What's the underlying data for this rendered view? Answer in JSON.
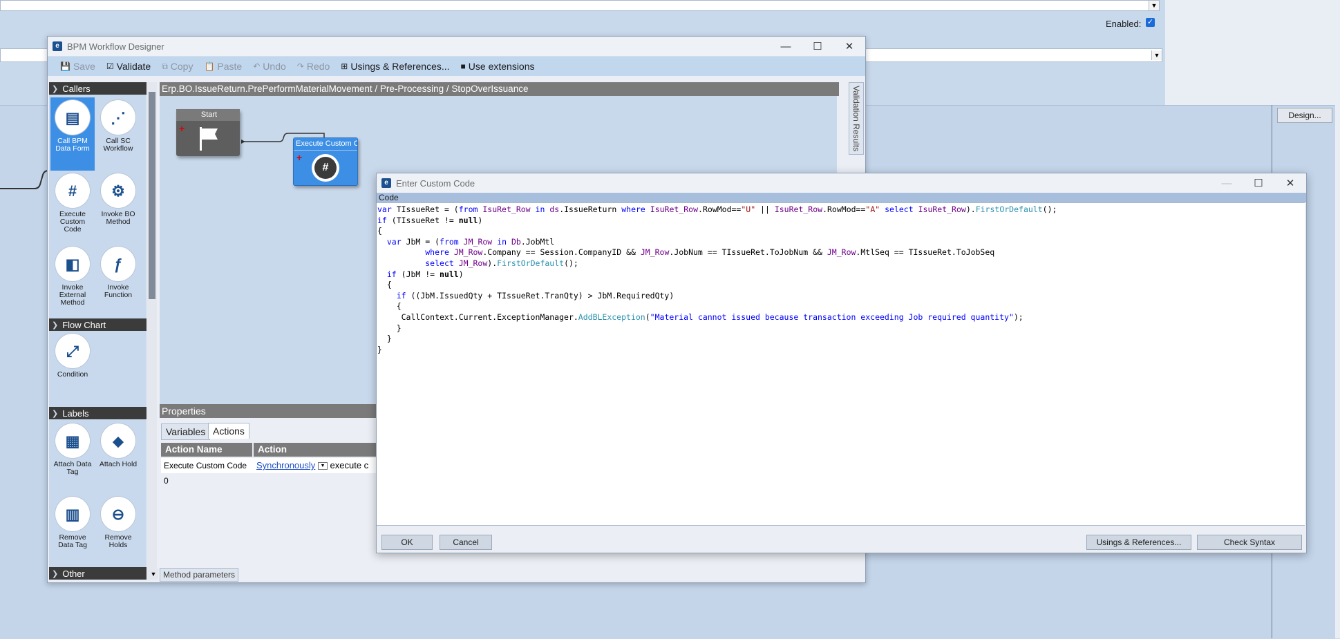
{
  "background": {
    "enabled_label": "Enabled:",
    "enabled_checked": true,
    "design_button": "Design..."
  },
  "bpm_window": {
    "title": "BPM Workflow Designer",
    "toolbar": {
      "save": "Save",
      "validate": "Validate",
      "copy": "Copy",
      "paste": "Paste",
      "undo": "Undo",
      "redo": "Redo",
      "usings": "Usings & References...",
      "extensions": "Use extensions"
    },
    "path": "Erp.BO.IssueReturn.PrePerformMaterialMovement / Pre-Processing / StopOverIssuance",
    "validation_tab": "Validation Results",
    "toolbox": {
      "callers_header": "Callers",
      "callers": [
        {
          "label": "Call BPM Data Form",
          "icon": "form-icon"
        },
        {
          "label": "Call SC Workflow",
          "icon": "workflow-icon"
        },
        {
          "label": "Execute Custom Code",
          "icon": "hash-document-icon"
        },
        {
          "label": "Invoke BO Method",
          "icon": "bo-method-icon"
        },
        {
          "label": "Invoke External Method",
          "icon": "external-method-icon"
        },
        {
          "label": "Invoke Function",
          "icon": "function-icon"
        }
      ],
      "flowchart_header": "Flow Chart",
      "flowchart": [
        {
          "label": "Condition",
          "icon": "condition-icon"
        }
      ],
      "labels_header": "Labels",
      "labels": [
        {
          "label": "Attach Data Tag",
          "icon": "data-tag-icon"
        },
        {
          "label": "Attach Hold",
          "icon": "hold-icon"
        },
        {
          "label": "Remove Data Tag",
          "icon": "remove-data-tag-icon"
        },
        {
          "label": "Remove Holds",
          "icon": "remove-hold-icon"
        }
      ],
      "other_header": "Other"
    },
    "nodes": {
      "start": "Start",
      "execute": "Execute Custom Co"
    },
    "properties": {
      "header": "Properties",
      "tabs": [
        "Variables",
        "Actions"
      ],
      "columns": [
        "Action Name",
        "Action"
      ],
      "row": {
        "name": "Execute Custom Code 0",
        "link": "Synchronously",
        "rest": "execute c"
      },
      "method_params_tab": "Method parameters"
    }
  },
  "code_dialog": {
    "title": "Enter Custom Code",
    "code_header": "Code",
    "buttons": {
      "ok": "OK",
      "cancel": "Cancel",
      "usings": "Usings & References...",
      "check": "Check Syntax"
    }
  },
  "colors": {
    "accent": "#3d8fe6",
    "toolbar": "#c1d7ee",
    "header_dark": "#3b3b3b"
  }
}
